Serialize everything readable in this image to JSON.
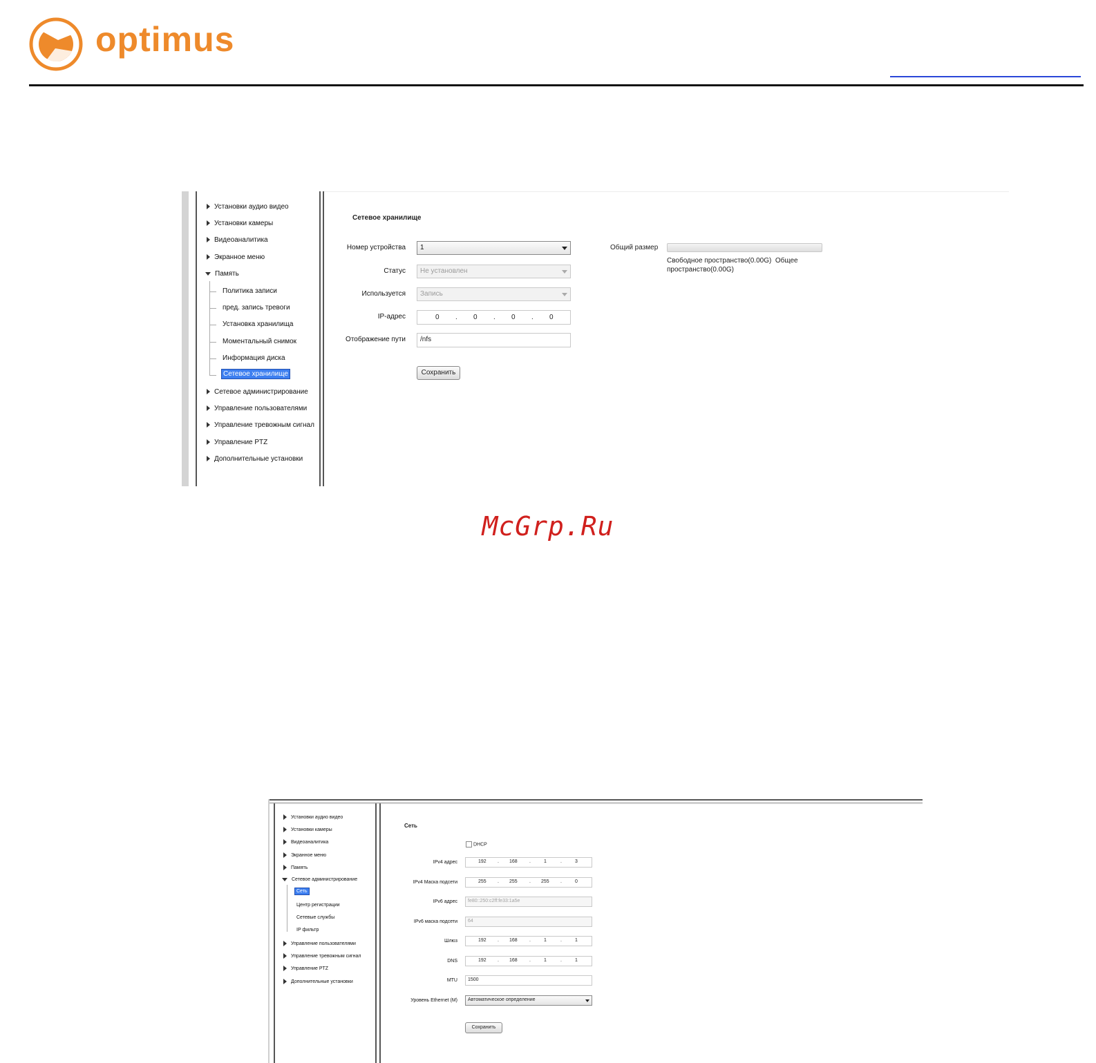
{
  "brand": {
    "name": "optimus",
    "color": "#ee8a2b"
  },
  "watermark": "McGrp.Ru",
  "panel1": {
    "tree": [
      {
        "label": "Установки аудио видео",
        "expanded": false
      },
      {
        "label": "Установки камеры",
        "expanded": false
      },
      {
        "label": "Видеоаналитика",
        "expanded": false
      },
      {
        "label": "Экранное меню",
        "expanded": false
      },
      {
        "label": "Память",
        "expanded": true,
        "children": [
          "Политика записи",
          "пред. запись тревоги",
          "Установка хранилища",
          "Моментальный снимок",
          "Информация диска",
          "Сетевое хранилище"
        ]
      },
      {
        "label": "Сетевое администрирование",
        "expanded": false
      },
      {
        "label": "Управление пользователями",
        "expanded": false
      },
      {
        "label": "Управление тревожным сигнал",
        "expanded": false
      },
      {
        "label": "Управление PTZ",
        "expanded": false
      },
      {
        "label": "Дополнительные установки",
        "expanded": false
      }
    ],
    "selected_child": "Сетевое хранилище",
    "title": "Сетевое хранилище",
    "form": {
      "device_label": "Номер устройства",
      "device_value": "1",
      "status_label": "Статус",
      "status_value": "Не установлен",
      "used_label": "Используется",
      "used_value": "Запись",
      "ip_label": "IP-адрес",
      "ip_octets": [
        "0",
        "0",
        "0",
        "0"
      ],
      "path_label": "Отображение пути",
      "path_value": "/nfs",
      "save_label": "Сохранить"
    },
    "capacity": {
      "label": "Общий размер",
      "fill_fraction": 0,
      "text_line1": "Свободное пространство(0.00G)  Общее",
      "text_line2": "пространство(0.00G)"
    }
  },
  "panel2": {
    "tree": [
      {
        "label": "Установки аудио видео"
      },
      {
        "label": "Установки камеры"
      },
      {
        "label": "Видеоаналитика"
      },
      {
        "label": "Экранное меню"
      },
      {
        "label": "Память"
      },
      {
        "label": "Сетевое администрирование",
        "expanded": true,
        "children": [
          "Сеть",
          "Центр регистрации",
          "Сетевые службы",
          "IP фильтр"
        ]
      },
      {
        "label": "Управление пользователями"
      },
      {
        "label": "Управление тревожным сигнал"
      },
      {
        "label": "Управление PTZ"
      },
      {
        "label": "Дополнительные установки"
      }
    ],
    "selected_child": "Сеть",
    "title": "Сеть",
    "form": {
      "dhcp_label": "DHCP",
      "dhcp_checked": false,
      "ipv4_label": "IPv4 адрес",
      "ipv4": [
        "192",
        "168",
        "1",
        "3"
      ],
      "mask_label": "IPv4 Маска подсети",
      "mask": [
        "255",
        "255",
        "255",
        "0"
      ],
      "ipv6_label": "IPv6 адрес",
      "ipv6_value": "fe80::250:c2ff:fe33:1a5e",
      "ipv6mask_label": "IPv6 маска подсети",
      "ipv6mask_value": "64",
      "gateway_label": "Шлюз",
      "gateway": [
        "192",
        "168",
        "1",
        "1"
      ],
      "dns_label": "DNS",
      "dns": [
        "192",
        "168",
        "1",
        "1"
      ],
      "mtu_label": "MTU",
      "mtu_value": "1500",
      "eth_label": "Уровень Ethernet (M)",
      "eth_value": "Автоматическое определение",
      "save_label": "Сохранить"
    }
  }
}
